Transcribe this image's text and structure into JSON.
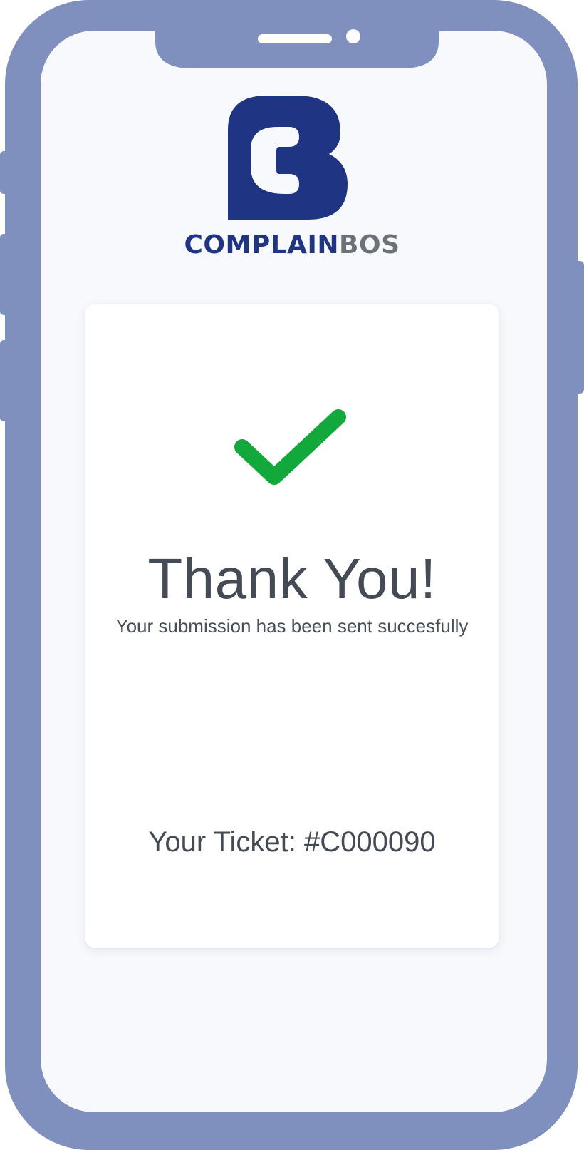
{
  "brand": {
    "name_part_1": "COMPLAIN",
    "name_part_2": "BOS",
    "primary_color": "#1f3482",
    "secondary_color": "#6e7278"
  },
  "device": {
    "frame_color": "#7f8fbe",
    "screen_color": "#f8f9fc"
  },
  "confirmation": {
    "icon": "check-icon",
    "icon_color": "#12a83c",
    "title": "Thank You!",
    "message": "Your submission has been sent succesfully",
    "ticket": "Your Ticket: #C000090"
  }
}
